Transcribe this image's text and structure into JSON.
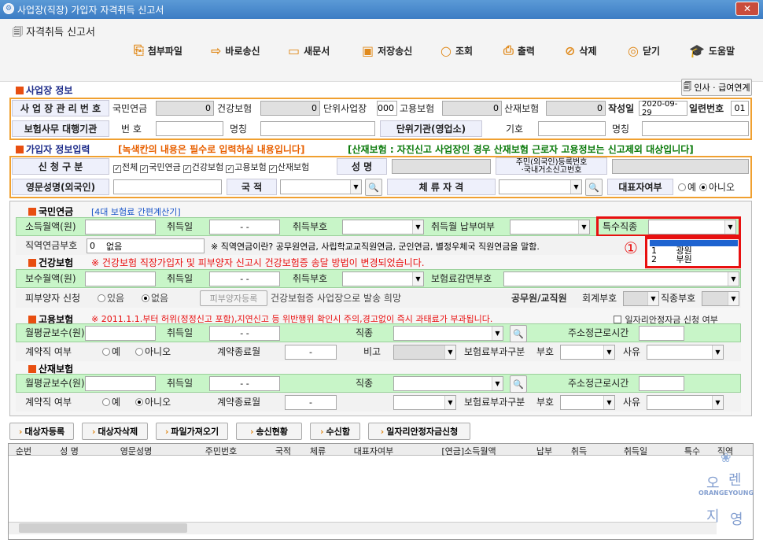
{
  "window": {
    "title": "사업장(직장) 가입자 자격취득 신고서",
    "close": "✕"
  },
  "toolbar": {
    "doc": "자격취득 신고서",
    "buttons": [
      "첨부파일",
      "바로송신",
      "새문서",
      "저장송신",
      "조회",
      "출력",
      "삭제",
      "닫기",
      "도움말"
    ],
    "hr_link": "인사 · 급여연계"
  },
  "workplace": {
    "section": "사업장 정보",
    "mgmt_label": "사 업 장 관 리 번 호",
    "pension": "국민연금",
    "pension_val": "0",
    "health": "건강보험",
    "health_val": "0",
    "unit": "단위사업장",
    "unit_val": "000",
    "employ": "고용보험",
    "employ_val": "0",
    "industrial": "산재보험",
    "industrial_val": "0",
    "date_label": "작성일",
    "date": "2020-09-29",
    "serial_label": "일련번호",
    "serial": "01",
    "agency_label": "보험사무 대행기관",
    "no_label": "번 호",
    "name_label": "명칭",
    "unitorg_label": "단위기관(영업소)",
    "sign_label": "기호",
    "name2_label": "명칭"
  },
  "member": {
    "section": "가입자 정보입력",
    "notice": "[녹색칸의 내용은 필수로 입력하실 내용입니다]",
    "notice2": "[산재보험 : 자진신고 사업장인 경우 산재보험 근로자 고용정보는 신고제외 대상입니다]",
    "apply_label": "신 청 구 분",
    "checks": [
      "전체",
      "국민연금",
      "건강보험",
      "고용보험",
      "산재보험"
    ],
    "name_label": "성 명",
    "rrn_label1": "주민(외국인)등록번호",
    "rrn_label2": "·국내거소신고번호",
    "eng_label": "영문성명(외국인)",
    "nation_label": "국 적",
    "stay_label": "체 류 자 격",
    "rep_label": "대표자여부",
    "yes": "예",
    "no": "아니오"
  },
  "np": {
    "title": "국민연금",
    "calc": "[4대 보험료 간편계산기]",
    "income": "소득월액(원)",
    "acq_date": "취득일",
    "date_ph": "- -",
    "acq_code": "취득부호",
    "pay": "취득월 납부여부",
    "special": "특수직종",
    "job_label": "직역연금부호",
    "job_val": "0",
    "job_text": "없음",
    "job_note": "※ 직역연금이란? 공무원연금, 사립학교교직원연금, 군인연금, 별정우체국 직원연금을 말함.",
    "options": [
      "1",
      "광원",
      "2",
      "부원"
    ],
    "circle": "①"
  },
  "hi": {
    "title": "건강보험",
    "note": "※ 건강보험 직장가입자 및 피부양자 신고시 건강보험증 송달 방법이 변경되었습니다.",
    "pay": "보수월액(원)",
    "acq_date": "취득일",
    "acq_code": "취득부호",
    "reduce": "보험료감면부호",
    "dep": "피부양자 신청",
    "have": "있음",
    "none": "없음",
    "dep_btn": "피부양자등록",
    "card": "건강보험증 사업장으로 발송 희망",
    "civil": "공무원/교직원",
    "acct": "회계부호",
    "job": "직종부호"
  },
  "ei": {
    "title": "고용보험",
    "note": "※ 2011.1.1.부터 허위(정정신고 포함),지연신고 등 위반행위 확인시 주의,경고없이 즉시 과태료가 부과됩니다.",
    "subsidy": "일자리안정자금 신청 여부",
    "wage": "월평균보수(원)",
    "acq_date": "취득일",
    "occ": "직종",
    "hours": "주소정근로시간",
    "contract": "계약직 여부",
    "yes": "예",
    "no": "아니오",
    "end": "계약종료월",
    "end_ph": "-",
    "note2": "비고",
    "levy": "보험료부과구분",
    "code": "부호",
    "reason": "사유"
  },
  "ii": {
    "title": "산재보험",
    "wage": "월평균보수(원)",
    "acq_date": "취득일",
    "occ": "직종",
    "hours": "주소정근로시간",
    "contract": "계약직 여부",
    "yes": "예",
    "no": "아니오",
    "end": "계약종료월",
    "end_ph": "-",
    "levy": "보험료부과구분",
    "code": "부호",
    "reason": "사유"
  },
  "actions": [
    "대상자등록",
    "대상자삭제",
    "파일가져오기",
    "송신현황",
    "수신함",
    "일자리안정자금신청"
  ],
  "table": {
    "headers": [
      "순번",
      "성 명",
      "영문성명",
      "주민번호",
      "국적",
      "체류",
      "대표자여부",
      "[연금]소득월액",
      "납부",
      "취득",
      "취득일",
      "특수",
      "직역"
    ]
  },
  "logo": {
    "t1": "오",
    "t2": "렌",
    "t3": "지",
    "t4": "영",
    "e1": "ORANGE",
    "e2": "YOUNG"
  }
}
